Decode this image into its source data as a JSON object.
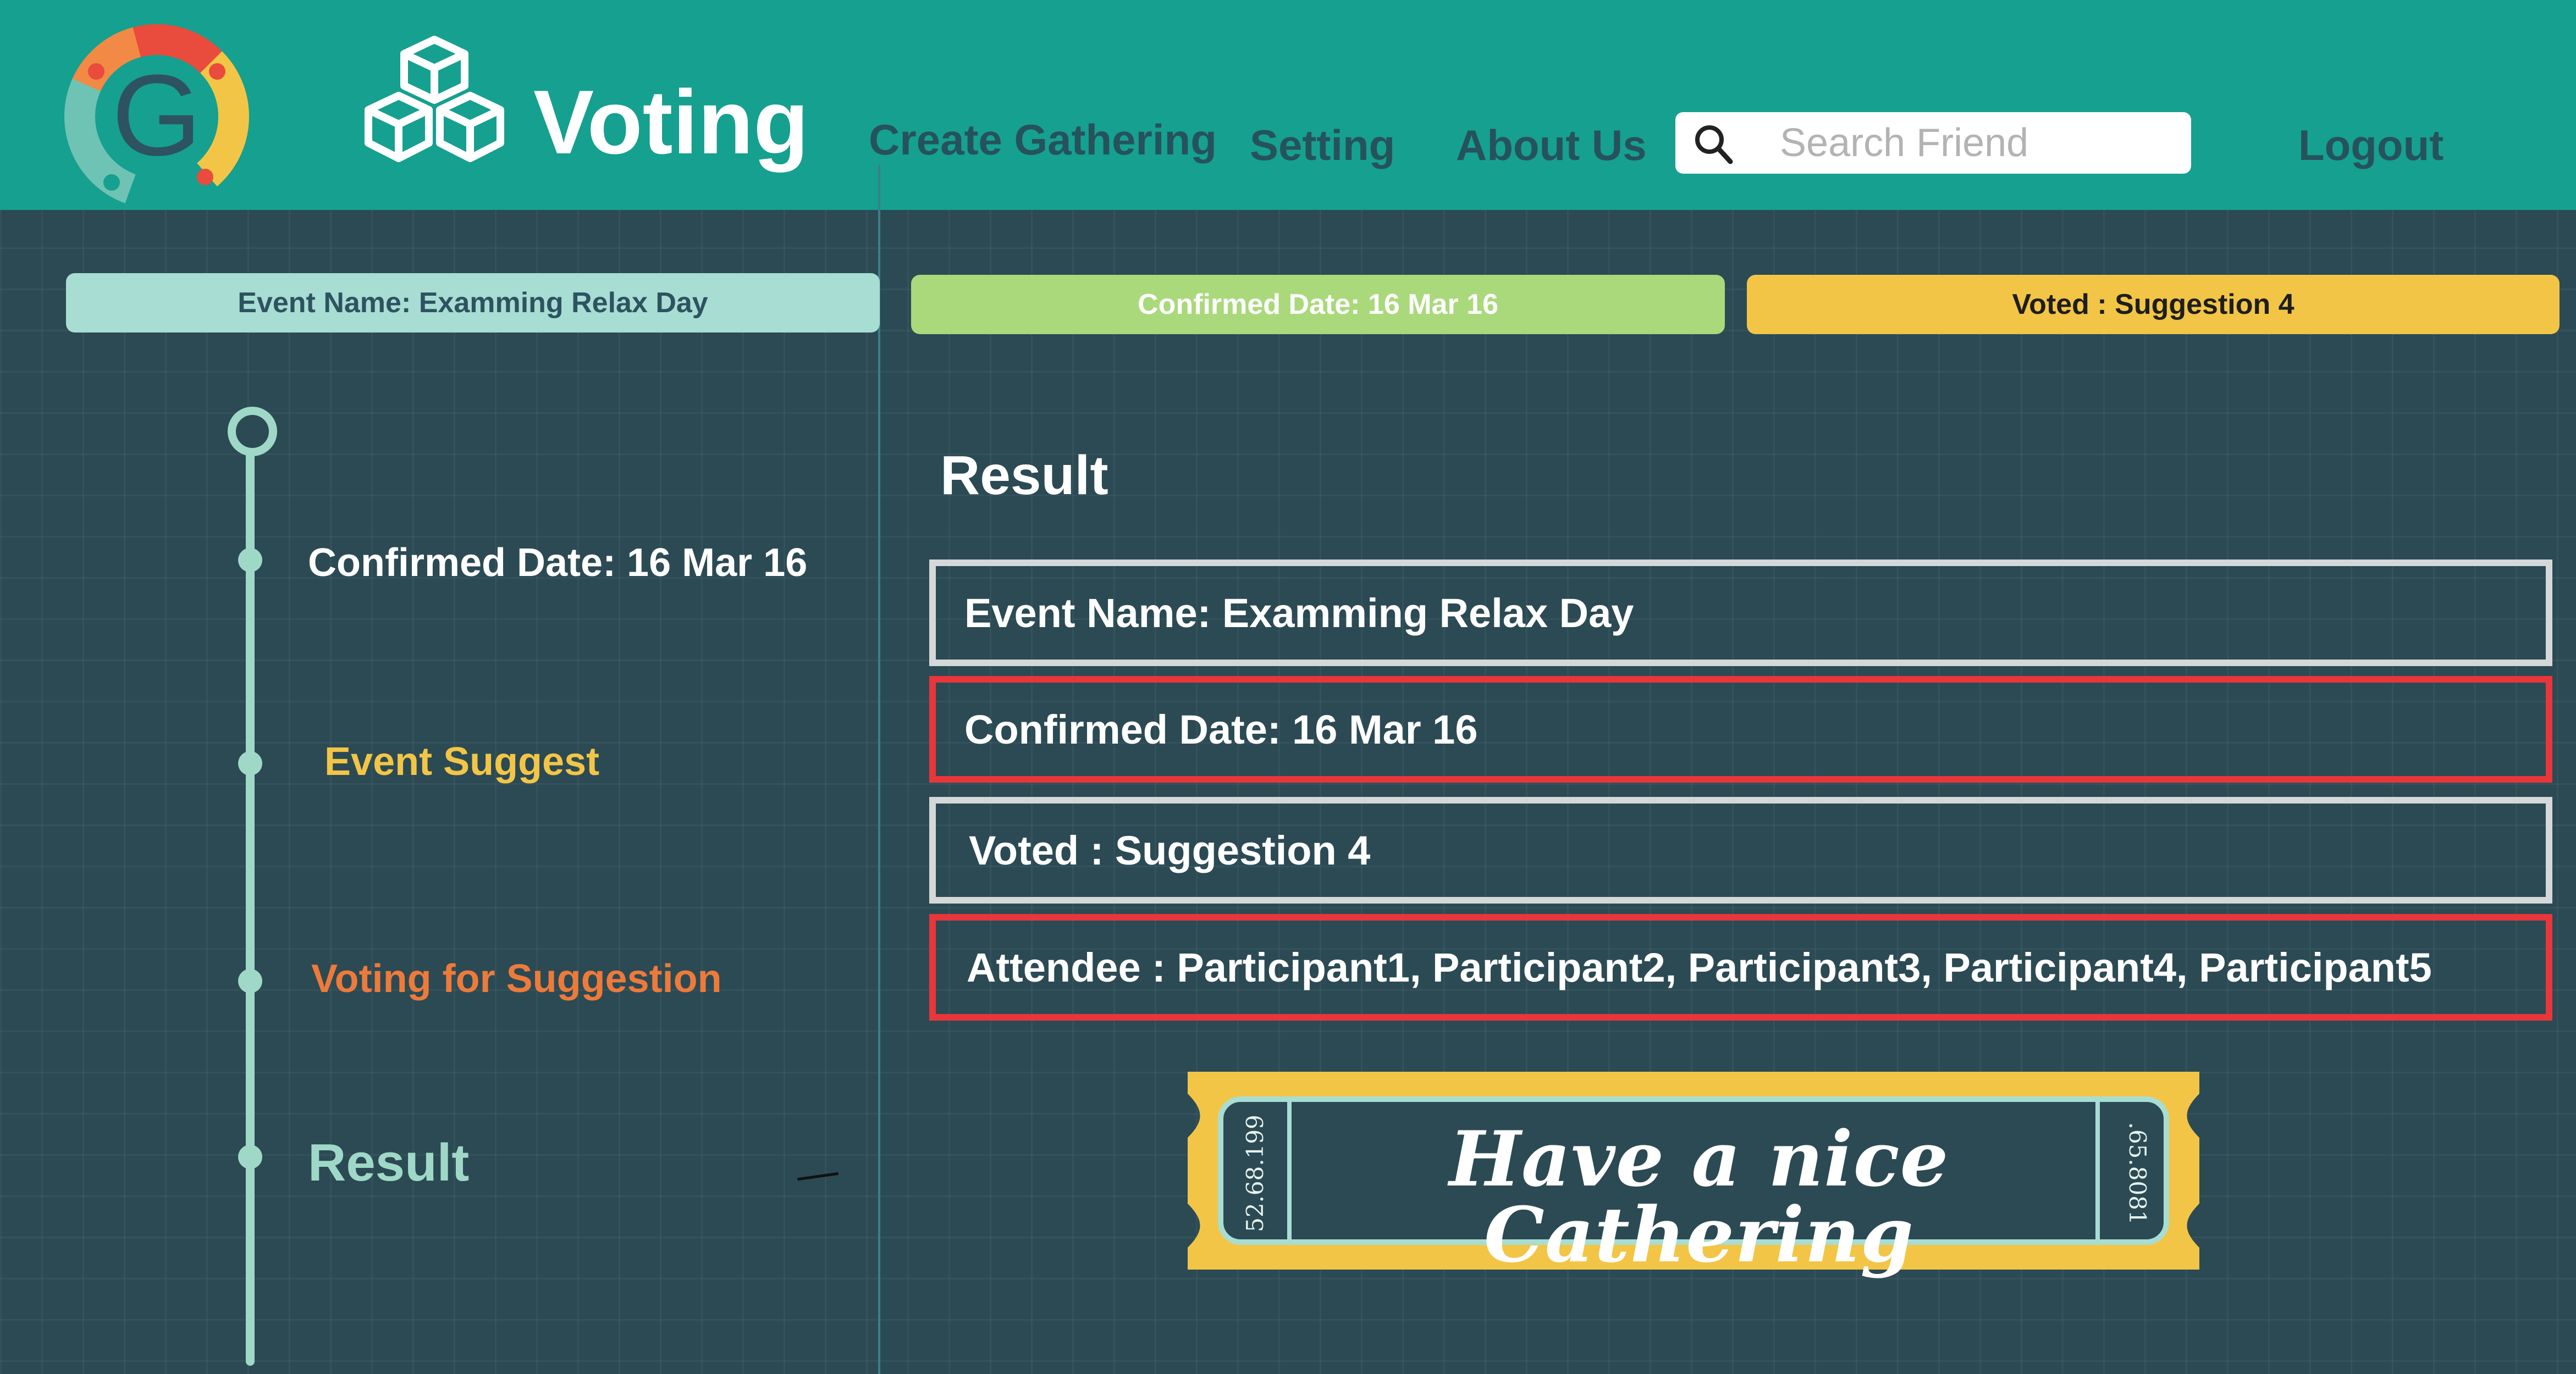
{
  "header": {
    "app_title": "Voting",
    "nav": {
      "create_gathering": "Create Gathering",
      "setting": "Setting",
      "about_us": "About Us",
      "logout": "Logout"
    },
    "search": {
      "placeholder": "Search Friend",
      "value": ""
    }
  },
  "summary": {
    "event_name": "Event Name: Examming Relax Day",
    "confirmed_date": "Confirmed Date: 16 Mar 16",
    "voted": "Voted : Suggestion 4"
  },
  "timeline": {
    "items": [
      {
        "label": "Confirmed Date: 16 Mar 16"
      },
      {
        "label": "Event Suggest"
      },
      {
        "label": "Voting for Suggestion"
      },
      {
        "label": "Result"
      }
    ]
  },
  "result": {
    "title": "Result",
    "event_name": "Event Name: Examming Relax Day",
    "confirmed_date": "Confirmed Date: 16 Mar 16",
    "voted": "Voted : Suggestion 4",
    "attendee": "Attendee : Participant1, Participant2, Participant3, Participant4, Participant5"
  },
  "ticket": {
    "text": "Have a nice Cathering",
    "serial_left": "52.68.199",
    "serial_right": ".65.8081"
  },
  "colors": {
    "header_bg": "#16a08f",
    "page_bg": "#2b4a54",
    "nav_text": "#26525c",
    "pill_event": "#a8ddd3",
    "pill_date": "#a9d97b",
    "pill_voted": "#f3c546",
    "timeline": "#9fd8c7",
    "accent_yellow": "#f3c546",
    "accent_orange": "#ee7a3a",
    "box_red": "#e8363a",
    "box_gray": "#d5d8d8"
  },
  "icons": {
    "logo": "g-ring-logo-icon",
    "brand": "cubes-icon",
    "search": "search-icon"
  }
}
